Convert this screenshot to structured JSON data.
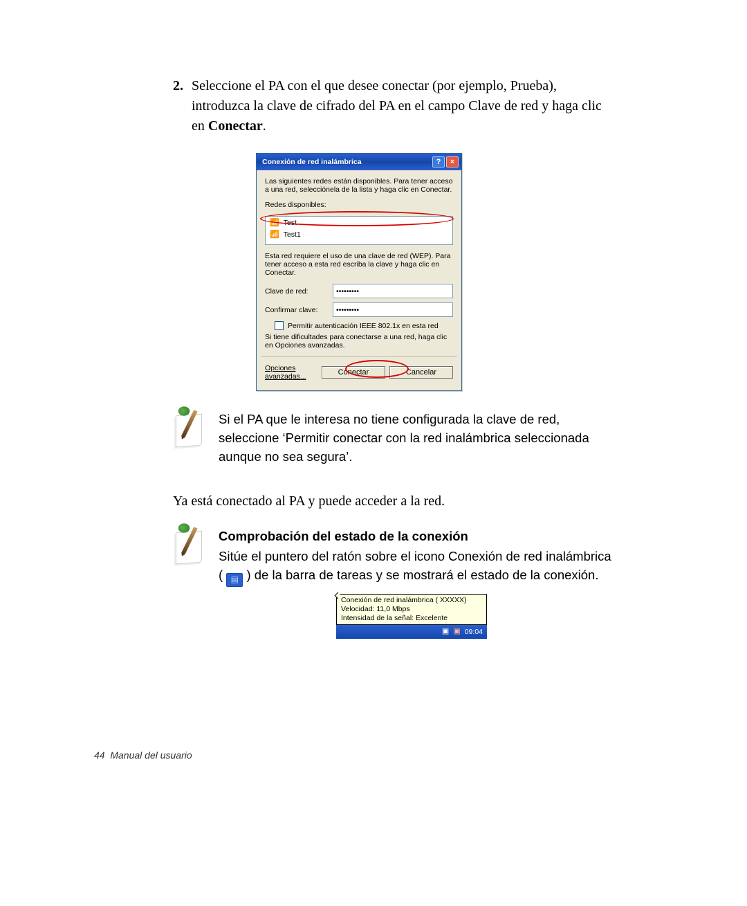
{
  "step": {
    "number": "2.",
    "text_a": "Seleccione el PA con el que desee conectar (por ejemplo, Prueba), introduzca la clave de cifrado del PA en el campo Clave de red y haga clic en ",
    "text_bold": "Conectar",
    "text_b": "."
  },
  "dialog": {
    "title": "Conexión de red inalámbrica",
    "help": "?",
    "close": "×",
    "intro": "Las siguientes redes están disponibles. Para tener acceso a una red, selecciónela de la lista y haga clic en Conectar.",
    "available_label": "Redes disponibles:",
    "networks": [
      "Test",
      "Test1"
    ],
    "wep_hint": "Esta red requiere el uso de una clave de red (WEP). Para tener acceso a esta red escriba la clave y haga clic en Conectar.",
    "key_label": "Clave de red:",
    "confirm_label": "Confirmar clave:",
    "key_value": "•••••••••",
    "confirm_value": "•••••••••",
    "ieee_label": "Permitir autenticación IEEE 802.1x en esta red",
    "trouble": "Si tiene dificultades para conectarse a una red, haga clic en Opciones avanzadas.",
    "btn_adv": "Opciones avanzadas...",
    "btn_connect": "Conectar",
    "btn_cancel": "Cancelar"
  },
  "note1": {
    "text": "Si el PA que le interesa no tiene configurada la clave de red, seleccione ‘Permitir conectar con la red inalámbrica seleccionada aunque no sea segura’."
  },
  "after": "Ya está conectado al PA y puede acceder a la red.",
  "note2": {
    "heading": "Comprobación del estado de la conexión",
    "text_a": "Sitúe el puntero del ratón sobre el icono Conexión de red inalámbrica (",
    "text_b": ") de la barra de tareas y se mostrará el estado de la conexión."
  },
  "tray_tooltip": {
    "line1": "Conexión de red inalámbrica ( XXXXX)",
    "line2": "Velocidad: 11,0 Mbps",
    "line3": "Intensidad de la señal: Excelente"
  },
  "taskbar": {
    "time": "09:04"
  },
  "footer": {
    "page": "44",
    "label": "Manual del usuario"
  }
}
